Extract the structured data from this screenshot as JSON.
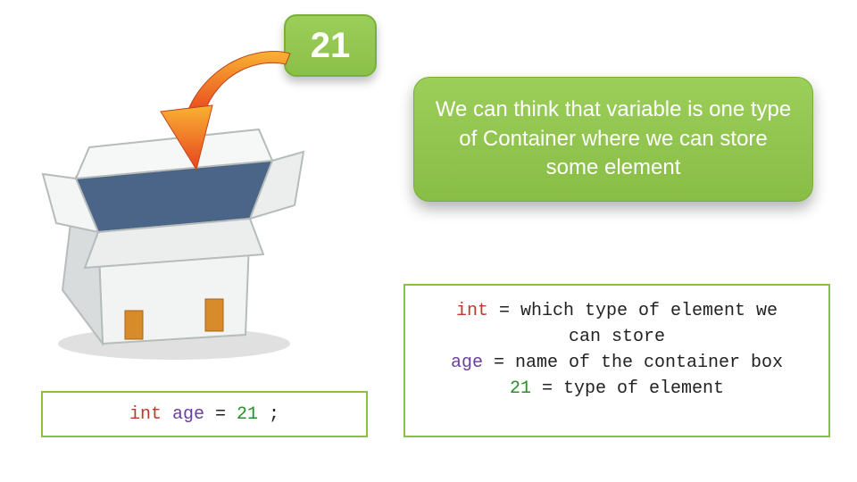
{
  "colors": {
    "green": "#8bc048",
    "orange_top": "#f9b233",
    "orange_bot": "#e8431f",
    "box_light": "#f2f3f3",
    "box_shadow": "#c9cccc",
    "box_inside": "#4a6587",
    "tape": "#d88b2a"
  },
  "badge": {
    "value": "21"
  },
  "callout": {
    "text": "We can think that variable is one type of Container where we can store some element"
  },
  "declaration": {
    "type_kw": "int",
    "var_name": "age",
    "assign": " = ",
    "value": "21",
    "terminator": " ;"
  },
  "explain": {
    "l1a": "int",
    "l1b": " = which type of element we",
    "l2": "can store",
    "l3a": "age",
    "l3b": " = name of the container box",
    "l4": "",
    "l5a": "21",
    "l5b": " = type of element"
  }
}
